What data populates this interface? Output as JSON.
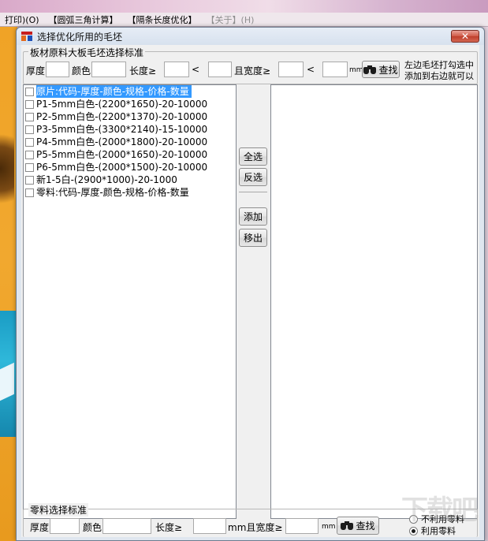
{
  "background_app": {
    "menu": [
      {
        "label": "打印)(O)",
        "enabled": true
      },
      {
        "label": "【圆弧三角计算】",
        "enabled": true
      },
      {
        "label": "【隔条长度优化】",
        "enabled": true
      },
      {
        "label": "【关于】(H)",
        "enabled": false
      }
    ]
  },
  "dialog": {
    "title": "选择优化所用的毛坯",
    "close_symbol": "✕"
  },
  "board_filter": {
    "legend": "板材原料大板毛坯选择标准",
    "thickness_label": "厚度",
    "thickness_value": "",
    "color_label": "颜色",
    "color_value": "",
    "length_label": "长度≥",
    "length_min": "",
    "length_lt": "<",
    "length_max": "",
    "width_label": "且宽度≥",
    "width_min": "",
    "width_lt": "<",
    "width_max": "",
    "unit": "mm",
    "find_label": "查找",
    "hint_line1": "左边毛坯打勾选中",
    "hint_line2": "添加到右边就可以"
  },
  "left_list": {
    "items": [
      {
        "label": "原片:代码-厚度-颜色-规格-价格-数量",
        "checked": false,
        "selected": true
      },
      {
        "label": "P1-5mm白色-(2200*1650)-20-10000",
        "checked": false,
        "selected": false
      },
      {
        "label": "P2-5mm白色-(2200*1370)-20-10000",
        "checked": false,
        "selected": false
      },
      {
        "label": "P3-5mm白色-(3300*2140)-15-10000",
        "checked": false,
        "selected": false
      },
      {
        "label": "P4-5mm白色-(2000*1800)-20-10000",
        "checked": false,
        "selected": false
      },
      {
        "label": "P5-5mm白色-(2000*1650)-20-10000",
        "checked": false,
        "selected": false
      },
      {
        "label": "P6-5mm白色-(2000*1500)-20-10000",
        "checked": false,
        "selected": false
      },
      {
        "label": "新1-5白-(2900*1000)-20-1000",
        "checked": false,
        "selected": false
      },
      {
        "label": "零料:代码-厚度-颜色-规格-价格-数量",
        "checked": false,
        "selected": false
      }
    ]
  },
  "middle_buttons": {
    "select_all": "全选",
    "invert": "反选",
    "add": "添加",
    "remove": "移出"
  },
  "right_list": {
    "items": []
  },
  "scrap_filter": {
    "legend": "零料选择标准",
    "thickness_label": "厚度",
    "thickness_value": "",
    "color_label": "颜色",
    "color_value": "",
    "length_label": "长度≥",
    "length_value": "",
    "width_label": "mm且宽度≥",
    "width_value": "",
    "unit": "mm",
    "find_label": "查找",
    "radio_no_scrap": "不利用零料",
    "radio_use_scrap": "利用零料",
    "selected_option": "use_scrap"
  },
  "watermark": "下载吧"
}
